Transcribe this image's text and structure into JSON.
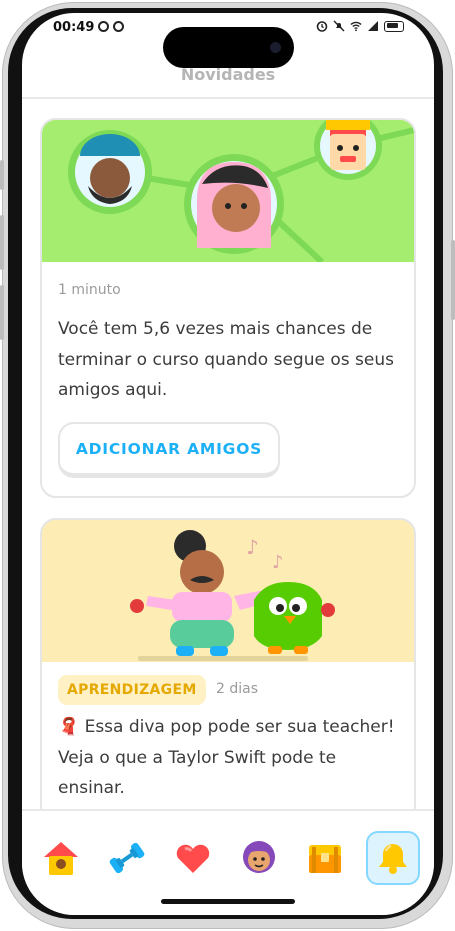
{
  "status_bar": {
    "time": "00:49"
  },
  "header": {
    "title": "Novidades"
  },
  "feed": {
    "card1": {
      "timestamp": "1 minuto",
      "text": "Você tem 5,6 vezes mais chances de terminar o curso quando segue os seus amigos aqui.",
      "button_label": "ADICIONAR AMIGOS"
    },
    "card2": {
      "tag": "APRENDIZAGEM",
      "timestamp": "2 dias",
      "emoji": "🧣",
      "text": "Essa diva pop pode ser sua teacher! Veja o que a Taylor Swift pode te ensinar."
    }
  },
  "bottom_nav": {
    "items": [
      {
        "icon": "home-icon",
        "active": false
      },
      {
        "icon": "dumbbell-icon",
        "active": false
      },
      {
        "icon": "heart-icon",
        "active": false
      },
      {
        "icon": "profile-icon",
        "active": false
      },
      {
        "icon": "treasure-chest-icon",
        "active": false
      },
      {
        "icon": "bell-icon",
        "active": true
      }
    ]
  },
  "colors": {
    "accent_blue": "#1cb0f6",
    "green_banner": "#a5ed6e",
    "yellow_banner": "#fdecb4",
    "tag_text": "#e5a800"
  }
}
